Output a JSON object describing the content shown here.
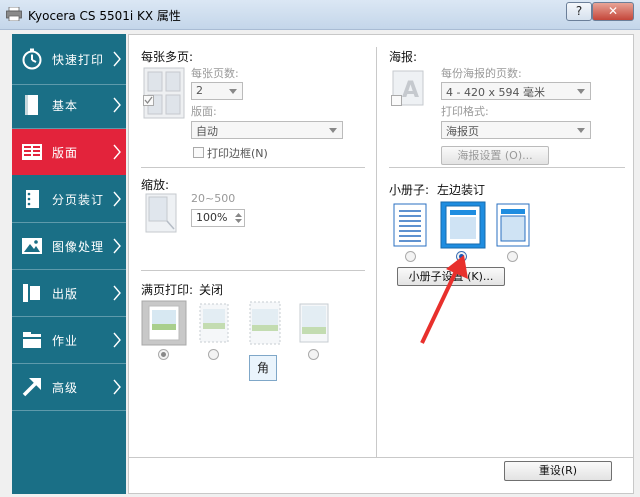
{
  "window": {
    "title": "Kyocera CS 5501i KX 属性",
    "help_label": "?",
    "close_label": "✕"
  },
  "sidebar": {
    "items": [
      {
        "label": "快速打印",
        "icon": "stopwatch-icon",
        "active": false
      },
      {
        "label": "基本",
        "icon": "document-icon",
        "active": false
      },
      {
        "label": "版面",
        "icon": "layout-grid-icon",
        "active": true
      },
      {
        "label": "分页装订",
        "icon": "binder-icon",
        "active": false
      },
      {
        "label": "图像处理",
        "icon": "image-icon",
        "active": false
      },
      {
        "label": "出版",
        "icon": "book-icon",
        "active": false
      },
      {
        "label": "作业",
        "icon": "job-folder-icon",
        "active": false
      },
      {
        "label": "高级",
        "icon": "arrow-icon",
        "active": false
      }
    ]
  },
  "multipage": {
    "title": "每张多页:",
    "pages_label": "每张页数:",
    "pages_value": "2",
    "layout_label": "版面:",
    "layout_value": "自动",
    "border_label": "打印边框",
    "border_key": "(N)"
  },
  "zoom": {
    "title": "缩放:",
    "range": "20~500",
    "value": "100%"
  },
  "fullpage": {
    "title": "满页打印:",
    "status": "关闭",
    "tooltip": "角"
  },
  "poster": {
    "title": "海报:",
    "count_label": "每份海报的页数:",
    "count_value": "4 - 420 x 594 毫米",
    "format_label": "打印格式:",
    "format_value": "海报页",
    "settings_button": "海报设置 (O)..."
  },
  "booklet": {
    "title": "小册子:",
    "status": "左边装订",
    "settings_button": "小册子设置 (K)..."
  },
  "reset_button": "重设(R)",
  "colors": {
    "sidebar": "#1a6f86",
    "active": "#e3233b",
    "selection": "#1f8de0",
    "annotation_arrow": "#e8302c"
  }
}
